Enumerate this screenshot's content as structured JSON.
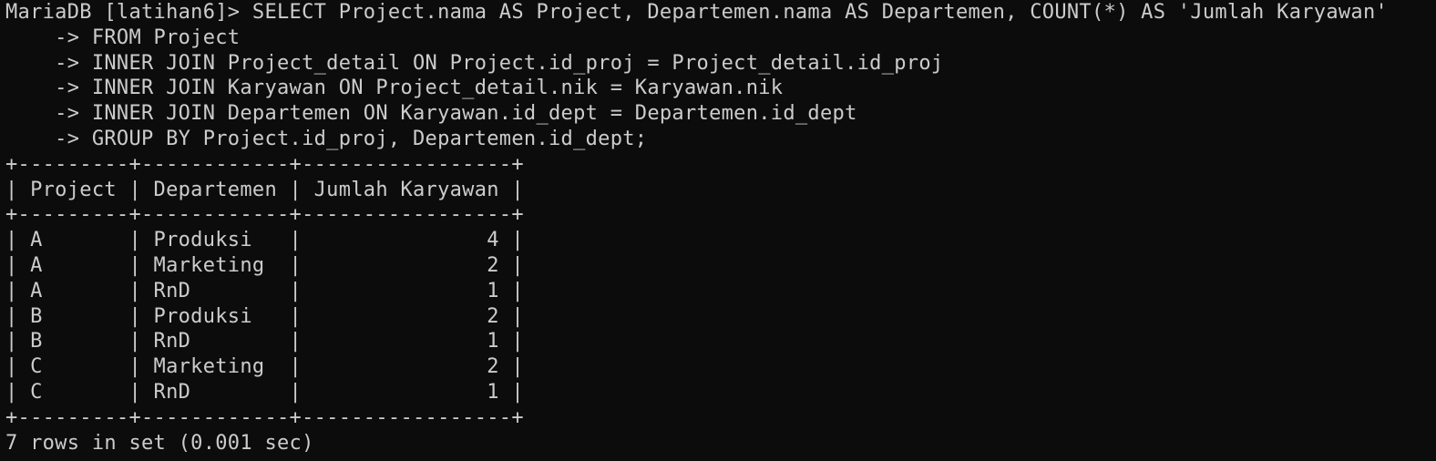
{
  "terminal": {
    "prompt": "MariaDB [latihan6]> ",
    "query_lines": [
      "SELECT Project.nama AS Project, Departemen.nama AS Departemen, COUNT(*) AS 'Jumlah Karyawan'",
      "    -> FROM Project",
      "    -> INNER JOIN Project_detail ON Project.id_proj = Project_detail.id_proj",
      "    -> INNER JOIN Karyawan ON Project_detail.nik = Karyawan.nik",
      "    -> INNER JOIN Departemen ON Karyawan.id_dept = Departemen.id_dept",
      "    -> GROUP BY Project.id_proj, Departemen.id_dept;"
    ],
    "table": {
      "border": "+---------+------------+-----------------+",
      "header": "| Project | Departemen | Jumlah Karyawan |",
      "rows": [
        "| A       | Produksi   |               4 |",
        "| A       | Marketing  |               2 |",
        "| A       | RnD        |               1 |",
        "| B       | Produksi   |               2 |",
        "| B       | RnD        |               1 |",
        "| C       | Marketing  |               2 |",
        "| C       | RnD        |               1 |"
      ]
    },
    "status": "7 rows in set (0.001 sec)"
  },
  "colors": {
    "background": "#0c0c0c",
    "foreground": "#cccccc"
  }
}
